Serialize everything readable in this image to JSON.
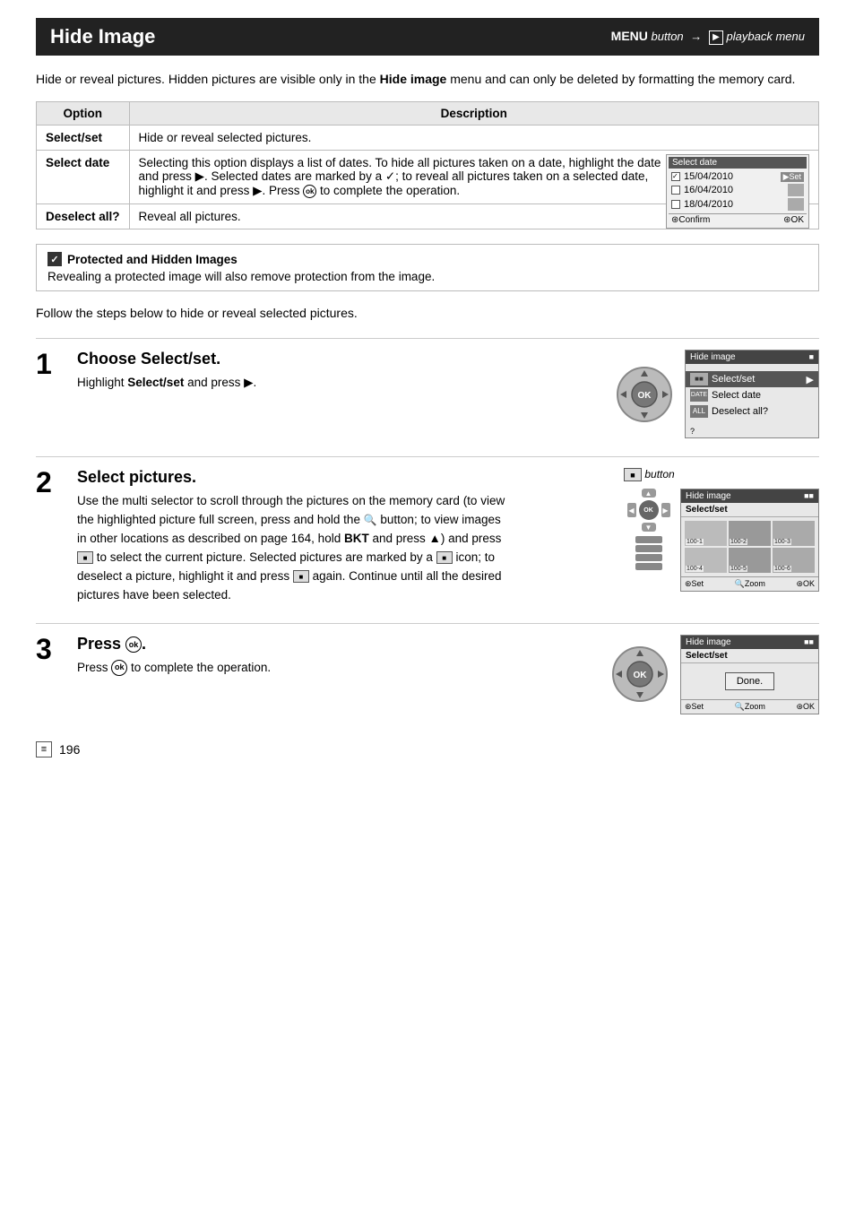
{
  "header": {
    "title": "Hide Image",
    "menu_label": "MENU",
    "button_label": "button",
    "arrow": "→",
    "playback_icon": "▶",
    "playback_text": "playback menu"
  },
  "intro": {
    "text1": "Hide or reveal pictures.  Hidden pictures are visible only in the ",
    "bold": "Hide image",
    "text2": " menu and can only be deleted by formatting the memory card."
  },
  "table": {
    "col_option": "Option",
    "col_description": "Description",
    "rows": [
      {
        "option": "Select/set",
        "description": "Hide or reveal selected pictures."
      },
      {
        "option": "Select date",
        "description": "Selecting this option displays a list of dates. To hide all pictures taken on a date, highlight the date and press ▶. Selected dates are marked by a ✓; to reveal all pictures taken on a selected date, highlight it and press ▶. Press ⊛ to complete the operation."
      },
      {
        "option": "Deselect all?",
        "description": "Reveal all pictures."
      }
    ]
  },
  "select_date_screenshot": {
    "title": "Select date",
    "dates": [
      {
        "checked": true,
        "label": "15/04/2010",
        "has_set": true
      },
      {
        "checked": false,
        "label": "16/04/2010",
        "has_set": false
      },
      {
        "checked": false,
        "label": "18/04/2010",
        "has_set": false
      }
    ],
    "footer_left": "⊛Confirm",
    "footer_right": "⊛OK"
  },
  "note": {
    "icon": "✓",
    "title": "Protected and Hidden Images",
    "text": "Revealing a protected image will also remove protection from the image."
  },
  "follow_text": "Follow the steps below to hide or reveal selected pictures.",
  "steps": [
    {
      "number": "1",
      "title_pre": "Choose ",
      "title_bold": "Select/set.",
      "body_pre": "Highlight ",
      "body_bold": "Select/set",
      "body_post": " and press ▶.",
      "screen": {
        "title": "Hide image",
        "rows": [
          {
            "icon": "■■",
            "label": "Select/set",
            "arrow": "▶",
            "highlighted": true
          },
          {
            "icon": "DATE",
            "label": "Select date",
            "arrow": "",
            "highlighted": false
          },
          {
            "icon": "ALL",
            "label": "Deselect all?",
            "arrow": "",
            "highlighted": false
          }
        ]
      }
    },
    {
      "number": "2",
      "title": "Select pictures.",
      "button_label": "⊛■ button",
      "body": "Use the multi selector to scroll through the pictures on the memory card (to view the highlighted picture full screen, press and hold the 🔍 button; to view images in other locations as described on page 164, hold BKT and press ▲) and press ⊛■ to select the current picture.  Selected pictures are marked by a ■ icon; to deselect a picture, highlight it and press ⊛■ again. Continue until all the desired pictures have been selected.",
      "screen": {
        "title": "Hide image",
        "subtitle": "Select/set",
        "thumbnails": [
          {
            "label": "100-1",
            "selected": false
          },
          {
            "label": "100-2",
            "selected": false
          },
          {
            "label": "100-3",
            "selected": false
          },
          {
            "label": "100-4",
            "selected": false
          },
          {
            "label": "100-5",
            "selected": false
          },
          {
            "label": "100-6",
            "selected": false
          }
        ],
        "footer_left": "⊛Set",
        "footer_mid": "🔍Zoom",
        "footer_right": "⊛OK"
      }
    },
    {
      "number": "3",
      "title_pre": "Press ",
      "title_symbol": "⊛",
      "title_post": ".",
      "body_pre": "Press ",
      "body_symbol": "⊛",
      "body_post": " to complete the operation.",
      "screen": {
        "title": "Hide image",
        "subtitle": "Select/set",
        "done_text": "Done.",
        "footer_left": "⊛Set",
        "footer_mid": "🔍Zoom",
        "footer_right": "⊛OK"
      }
    }
  ],
  "page_number": "196"
}
